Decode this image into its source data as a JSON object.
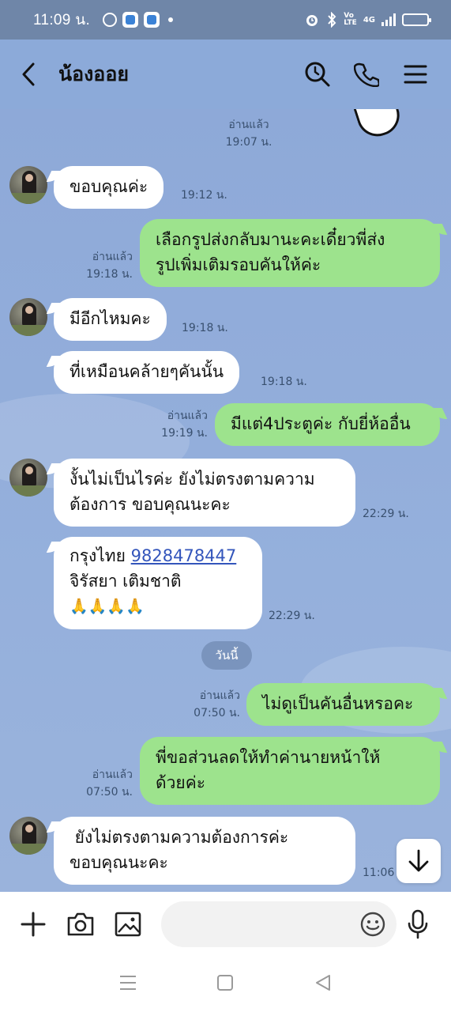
{
  "status_bar": {
    "time": "11:09 น.",
    "network": "4G"
  },
  "header": {
    "title": "น้องออย"
  },
  "chat": {
    "date_divider": "วันนี้",
    "messages": [
      {
        "side": "out",
        "meta_read": "อ่านแล้ว",
        "meta_time": "19:07 น."
      },
      {
        "side": "in",
        "text": "ขอบคุณค่ะ",
        "time": "19:12 น."
      },
      {
        "side": "out",
        "line1": "เลือกรูปส่งกลับมานะคะเดี๋ยวพี่ส่ง",
        "line2": "รูปเพิ่มเติมรอบคันให้ค่ะ",
        "read": "อ่านแล้ว",
        "time": "19:18 น."
      },
      {
        "side": "in",
        "text": "มีอีกไหมคะ",
        "time": "19:18 น."
      },
      {
        "side": "in",
        "text": "ที่เหมือนคล้ายๆคันนั้น",
        "time": "19:18 น."
      },
      {
        "side": "out",
        "text": "มีแต่4ประตูค่ะ กับยี่ห้ออื่น",
        "read": "อ่านแล้ว",
        "time": "19:19 น."
      },
      {
        "side": "in",
        "line1": "งั้นไม่เป็นไรค่ะ ยังไม่ตรงตามความ",
        "line2": "ต้องการ ขอบคุณนะคะ",
        "time": "22:29 น."
      },
      {
        "side": "in",
        "bank": "กรุงไทย",
        "account": "9828478447",
        "name": "จิรัสยา เติมชาติ",
        "emoji": "🙏🙏🙏🙏",
        "time": "22:29 น."
      },
      {
        "side": "out",
        "text": "ไม่ดูเป็นคันอื่นหรอคะ",
        "read": "อ่านแล้ว",
        "time": "07:50 น."
      },
      {
        "side": "out",
        "line1": "พี่ขอส่วนลดให้ทำค่านายหน้าให้",
        "line2": "ด้วยค่ะ",
        "read": "อ่านแล้ว",
        "time": "07:50 น."
      },
      {
        "side": "in",
        "line1": " ยังไม่ตรงตามความต้องการค่ะ",
        "line2": "ขอบคุณนะคะ",
        "time": "11:06"
      }
    ]
  },
  "input": {
    "value": ""
  },
  "colors": {
    "chat_bg": "#8caad9",
    "outgoing": "#9de38d",
    "incoming": "#ffffff",
    "status_bar": "#6f86a8"
  },
  "icons": [
    "back-icon",
    "search-icon",
    "phone-icon",
    "menu-icon",
    "plus-icon",
    "camera-icon",
    "image-icon",
    "emoji-icon",
    "mic-icon",
    "arrow-down-icon",
    "nav-recent-icon",
    "nav-home-icon",
    "nav-back-icon"
  ]
}
